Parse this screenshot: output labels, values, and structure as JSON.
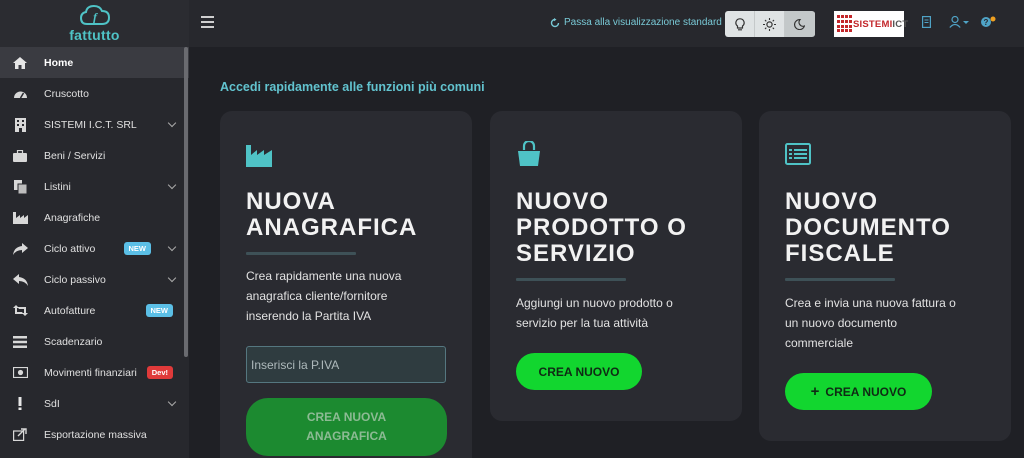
{
  "app": {
    "name": "fattutto",
    "brand_color": "#4fc3c6",
    "accent": "#12d62f"
  },
  "sidebar": {
    "items": [
      {
        "label": "Home",
        "icon": "home-icon",
        "active": true
      },
      {
        "label": "Cruscotto",
        "icon": "dashboard-icon"
      },
      {
        "label": "SISTEMI I.C.T. SRL",
        "icon": "building-icon",
        "expandable": true
      },
      {
        "label": "Beni / Servizi",
        "icon": "briefcase-icon"
      },
      {
        "label": "Listini",
        "icon": "copy-icon",
        "expandable": true
      },
      {
        "label": "Anagrafiche",
        "icon": "factory-icon"
      },
      {
        "label": "Ciclo attivo",
        "icon": "share-icon",
        "badge": "NEW",
        "expandable": true
      },
      {
        "label": "Ciclo passivo",
        "icon": "reply-icon",
        "expandable": true
      },
      {
        "label": "Autofatture",
        "icon": "retweet-icon",
        "badge": "NEW"
      },
      {
        "label": "Scadenzario",
        "icon": "list-icon"
      },
      {
        "label": "Movimenti finanziari",
        "icon": "money-icon",
        "badge": "Dev!"
      },
      {
        "label": "SdI",
        "icon": "exclamation-icon",
        "expandable": true
      },
      {
        "label": "Esportazione massiva",
        "icon": "export-icon"
      }
    ]
  },
  "topbar": {
    "switch_view_label": "Passa alla visualizzazione standard",
    "company_logo_text": "SISTEMI",
    "company_logo_suffix": "ICT"
  },
  "main": {
    "section_title": "Accedi rapidamente alle funzioni più comuni",
    "cards": [
      {
        "title": "NUOVA\nANAGRAFICA",
        "description": "Crea rapidamente una nuova\nanagrafica cliente/fornitore\ninserendo la Partita IVA",
        "input_placeholder": "Inserisci la P.IVA",
        "button_label": "CREA NUOVA\nANAGRAFICA"
      },
      {
        "title": "NUOVO\nPRODOTTO O\nSERVIZIO",
        "description": "Aggiungi un nuovo prodotto o\nservizio per la tua attività",
        "button_label": "CREA NUOVO"
      },
      {
        "title": "NUOVO\nDOCUMENTO\nFISCALE",
        "description": "Crea e invia una nuova fattura o\nun nuovo documento\ncommerciale",
        "button_label": "CREA NUOVO"
      }
    ]
  }
}
